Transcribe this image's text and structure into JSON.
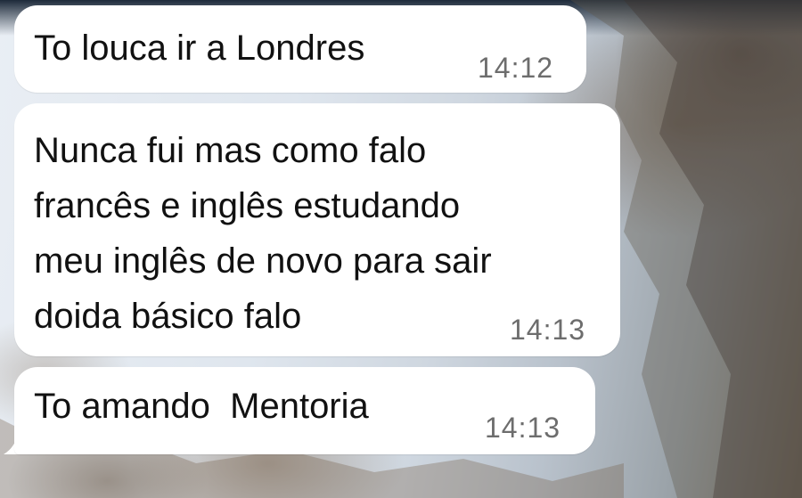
{
  "chat": {
    "messages": [
      {
        "text": "To louca ir a Londres",
        "time": "14:12"
      },
      {
        "text": "Nunca fui mas como falo\nfrancês e inglês estudando\nmeu inglês de novo para sair\ndoida básico falo",
        "time": "14:13"
      },
      {
        "text": "To amando  Mentoria",
        "time": "14:13"
      }
    ],
    "bubble_color": "#ffffff",
    "timestamp_color": "#6d6d6d",
    "wallpaper": "snowy mountain"
  }
}
